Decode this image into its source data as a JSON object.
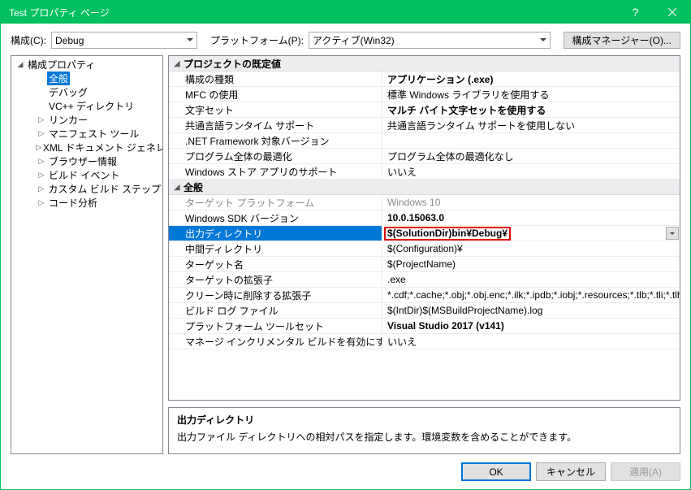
{
  "title": "Test プロパティ ページ",
  "toolbar": {
    "config_label": "構成(C):",
    "config_value": "Debug",
    "platform_label": "プラットフォーム(P):",
    "platform_value": "アクティブ(Win32)",
    "manager_button": "構成マネージャー(O)..."
  },
  "tree": {
    "root": "構成プロパティ",
    "items": [
      {
        "label": "全般",
        "selected": true,
        "depth": 1,
        "expandable": false
      },
      {
        "label": "デバッグ",
        "depth": 1,
        "expandable": false
      },
      {
        "label": "VC++ ディレクトリ",
        "depth": 1,
        "expandable": false
      },
      {
        "label": "リンカー",
        "depth": 1,
        "expandable": true
      },
      {
        "label": "マニフェスト ツール",
        "depth": 1,
        "expandable": true
      },
      {
        "label": "XML ドキュメント ジェネレーター",
        "depth": 1,
        "expandable": true
      },
      {
        "label": "ブラウザー情報",
        "depth": 1,
        "expandable": true
      },
      {
        "label": "ビルド イベント",
        "depth": 1,
        "expandable": true
      },
      {
        "label": "カスタム ビルド ステップ",
        "depth": 1,
        "expandable": true
      },
      {
        "label": "コード分析",
        "depth": 1,
        "expandable": true
      }
    ]
  },
  "groups": [
    {
      "title": "プロジェクトの既定値",
      "rows": [
        {
          "label": "構成の種類",
          "value": "アプリケーション (.exe)",
          "bold": true
        },
        {
          "label": "MFC の使用",
          "value": "標準 Windows ライブラリを使用する"
        },
        {
          "label": "文字セット",
          "value": "マルチ バイト文字セットを使用する",
          "bold": true
        },
        {
          "label": "共通言語ランタイム サポート",
          "value": "共通言語ランタイム サポートを使用しない"
        },
        {
          "label": ".NET Framework 対象バージョン",
          "value": ""
        },
        {
          "label": "プログラム全体の最適化",
          "value": "プログラム全体の最適化なし"
        },
        {
          "label": "Windows ストア アプリのサポート",
          "value": "いいえ"
        }
      ]
    },
    {
      "title": "全般",
      "rows": [
        {
          "label": "ターゲット プラットフォーム",
          "value": "Windows 10",
          "disabled": true
        },
        {
          "label": "Windows SDK バージョン",
          "value": "10.0.15063.0",
          "bold": true
        },
        {
          "label": "出力ディレクトリ",
          "value": "$(SolutionDir)bin¥Debug¥",
          "bold": true,
          "selected": true,
          "highlight": true,
          "dropdown": true
        },
        {
          "label": "中間ディレクトリ",
          "value": "$(Configuration)¥"
        },
        {
          "label": "ターゲット名",
          "value": "$(ProjectName)"
        },
        {
          "label": "ターゲットの拡張子",
          "value": ".exe"
        },
        {
          "label": "クリーン時に削除する拡張子",
          "value": "*.cdf;*.cache;*.obj;*.obj.enc;*.ilk;*.ipdb;*.iobj;*.resources;*.tlb;*.tli;*.tlh"
        },
        {
          "label": "ビルド ログ ファイル",
          "value": "$(IntDir)$(MSBuildProjectName).log"
        },
        {
          "label": "プラットフォーム ツールセット",
          "value": "Visual Studio 2017 (v141)",
          "bold": true
        },
        {
          "label": "マネージ インクリメンタル ビルドを有効にする",
          "value": "いいえ"
        }
      ]
    }
  ],
  "description": {
    "title": "出力ディレクトリ",
    "body": "出力ファイル ディレクトリへの相対パスを指定します。環境変数を含めることができます。"
  },
  "buttons": {
    "ok": "OK",
    "cancel": "キャンセル",
    "apply": "適用(A)"
  }
}
